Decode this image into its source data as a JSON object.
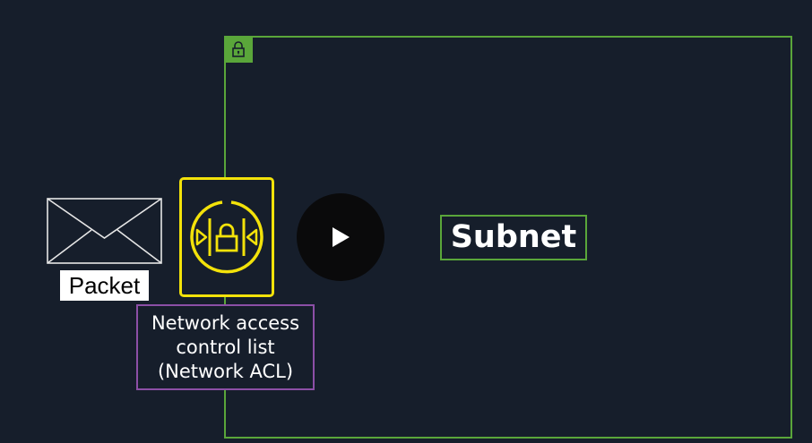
{
  "diagram": {
    "subnet": {
      "label": "Subnet",
      "icon": "lock-icon",
      "color": "#5aa63a"
    },
    "packet": {
      "label": "Packet",
      "icon": "envelope-icon"
    },
    "nacl": {
      "label_lines": [
        "Network access",
        "control list",
        "(Network ACL)"
      ],
      "icon": "network-acl-icon",
      "icon_color": "#f3e20a",
      "label_border_color": "#8c4fa6"
    }
  },
  "player": {
    "play_icon": "play-icon"
  },
  "colors": {
    "background": "#161e2b"
  }
}
